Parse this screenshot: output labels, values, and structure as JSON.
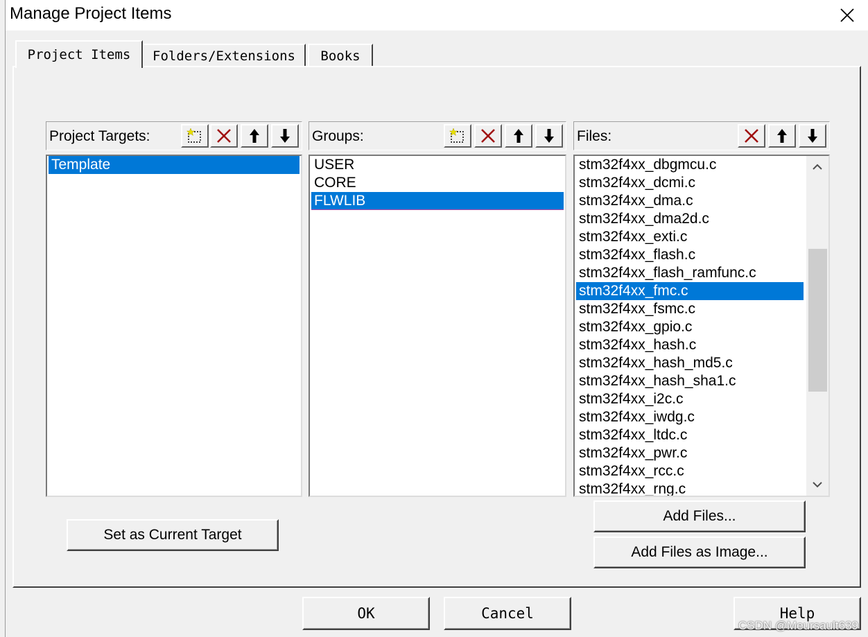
{
  "window": {
    "title": "Manage Project Items"
  },
  "tabs": [
    {
      "label": "Project Items",
      "active": true
    },
    {
      "label": "Folders/Extensions",
      "active": false
    },
    {
      "label": "Books",
      "active": false
    }
  ],
  "targets_panel": {
    "label": "Project Targets:",
    "items": [
      {
        "label": "Template",
        "selected": true
      }
    ]
  },
  "groups_panel": {
    "label": "Groups:",
    "items": [
      {
        "label": "USER",
        "selected": false
      },
      {
        "label": "CORE",
        "selected": false
      },
      {
        "label": "FLWLIB",
        "selected": true
      }
    ]
  },
  "files_panel": {
    "label": "Files:",
    "items": [
      {
        "label": "stm32f4xx_dbgmcu.c",
        "selected": false
      },
      {
        "label": "stm32f4xx_dcmi.c",
        "selected": false
      },
      {
        "label": "stm32f4xx_dma.c",
        "selected": false
      },
      {
        "label": "stm32f4xx_dma2d.c",
        "selected": false
      },
      {
        "label": "stm32f4xx_exti.c",
        "selected": false
      },
      {
        "label": "stm32f4xx_flash.c",
        "selected": false
      },
      {
        "label": "stm32f4xx_flash_ramfunc.c",
        "selected": false
      },
      {
        "label": "stm32f4xx_fmc.c",
        "selected": true
      },
      {
        "label": "stm32f4xx_fsmc.c",
        "selected": false
      },
      {
        "label": "stm32f4xx_gpio.c",
        "selected": false
      },
      {
        "label": "stm32f4xx_hash.c",
        "selected": false
      },
      {
        "label": "stm32f4xx_hash_md5.c",
        "selected": false
      },
      {
        "label": "stm32f4xx_hash_sha1.c",
        "selected": false
      },
      {
        "label": "stm32f4xx_i2c.c",
        "selected": false
      },
      {
        "label": "stm32f4xx_iwdg.c",
        "selected": false
      },
      {
        "label": "stm32f4xx_ltdc.c",
        "selected": false
      },
      {
        "label": "stm32f4xx_pwr.c",
        "selected": false
      },
      {
        "label": "stm32f4xx_rcc.c",
        "selected": false
      },
      {
        "label": "stm32f4xx_rng.c",
        "selected": false
      }
    ],
    "scroll_position": 0.4
  },
  "buttons": {
    "set_current_target": "Set as Current Target",
    "add_files": "Add Files...",
    "add_files_image": "Add Files as Image...",
    "ok": "OK",
    "cancel": "Cancel",
    "help": "Help"
  },
  "watermark": "CSDN @Meursault639",
  "colors": {
    "selection": "#0078d7",
    "delete_icon": "#a01010",
    "new_icon_star": "#e8e000"
  },
  "icons": {
    "new": "new-item-icon",
    "delete": "delete-icon",
    "move_up": "move-up-arrow-icon",
    "move_down": "move-down-arrow-icon",
    "close": "close-icon"
  }
}
